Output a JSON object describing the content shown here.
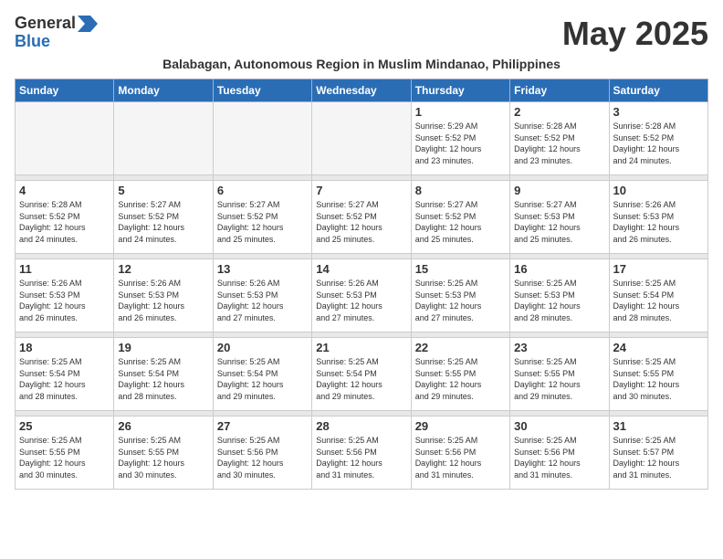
{
  "header": {
    "logo_general": "General",
    "logo_blue": "Blue",
    "month_title": "May 2025",
    "subtitle": "Balabagan, Autonomous Region in Muslim Mindanao, Philippines"
  },
  "weekdays": [
    "Sunday",
    "Monday",
    "Tuesday",
    "Wednesday",
    "Thursday",
    "Friday",
    "Saturday"
  ],
  "weeks": [
    [
      {
        "day": "",
        "info": ""
      },
      {
        "day": "",
        "info": ""
      },
      {
        "day": "",
        "info": ""
      },
      {
        "day": "",
        "info": ""
      },
      {
        "day": "1",
        "info": "Sunrise: 5:29 AM\nSunset: 5:52 PM\nDaylight: 12 hours\nand 23 minutes."
      },
      {
        "day": "2",
        "info": "Sunrise: 5:28 AM\nSunset: 5:52 PM\nDaylight: 12 hours\nand 23 minutes."
      },
      {
        "day": "3",
        "info": "Sunrise: 5:28 AM\nSunset: 5:52 PM\nDaylight: 12 hours\nand 24 minutes."
      }
    ],
    [
      {
        "day": "4",
        "info": "Sunrise: 5:28 AM\nSunset: 5:52 PM\nDaylight: 12 hours\nand 24 minutes."
      },
      {
        "day": "5",
        "info": "Sunrise: 5:27 AM\nSunset: 5:52 PM\nDaylight: 12 hours\nand 24 minutes."
      },
      {
        "day": "6",
        "info": "Sunrise: 5:27 AM\nSunset: 5:52 PM\nDaylight: 12 hours\nand 25 minutes."
      },
      {
        "day": "7",
        "info": "Sunrise: 5:27 AM\nSunset: 5:52 PM\nDaylight: 12 hours\nand 25 minutes."
      },
      {
        "day": "8",
        "info": "Sunrise: 5:27 AM\nSunset: 5:52 PM\nDaylight: 12 hours\nand 25 minutes."
      },
      {
        "day": "9",
        "info": "Sunrise: 5:27 AM\nSunset: 5:53 PM\nDaylight: 12 hours\nand 25 minutes."
      },
      {
        "day": "10",
        "info": "Sunrise: 5:26 AM\nSunset: 5:53 PM\nDaylight: 12 hours\nand 26 minutes."
      }
    ],
    [
      {
        "day": "11",
        "info": "Sunrise: 5:26 AM\nSunset: 5:53 PM\nDaylight: 12 hours\nand 26 minutes."
      },
      {
        "day": "12",
        "info": "Sunrise: 5:26 AM\nSunset: 5:53 PM\nDaylight: 12 hours\nand 26 minutes."
      },
      {
        "day": "13",
        "info": "Sunrise: 5:26 AM\nSunset: 5:53 PM\nDaylight: 12 hours\nand 27 minutes."
      },
      {
        "day": "14",
        "info": "Sunrise: 5:26 AM\nSunset: 5:53 PM\nDaylight: 12 hours\nand 27 minutes."
      },
      {
        "day": "15",
        "info": "Sunrise: 5:25 AM\nSunset: 5:53 PM\nDaylight: 12 hours\nand 27 minutes."
      },
      {
        "day": "16",
        "info": "Sunrise: 5:25 AM\nSunset: 5:53 PM\nDaylight: 12 hours\nand 28 minutes."
      },
      {
        "day": "17",
        "info": "Sunrise: 5:25 AM\nSunset: 5:54 PM\nDaylight: 12 hours\nand 28 minutes."
      }
    ],
    [
      {
        "day": "18",
        "info": "Sunrise: 5:25 AM\nSunset: 5:54 PM\nDaylight: 12 hours\nand 28 minutes."
      },
      {
        "day": "19",
        "info": "Sunrise: 5:25 AM\nSunset: 5:54 PM\nDaylight: 12 hours\nand 28 minutes."
      },
      {
        "day": "20",
        "info": "Sunrise: 5:25 AM\nSunset: 5:54 PM\nDaylight: 12 hours\nand 29 minutes."
      },
      {
        "day": "21",
        "info": "Sunrise: 5:25 AM\nSunset: 5:54 PM\nDaylight: 12 hours\nand 29 minutes."
      },
      {
        "day": "22",
        "info": "Sunrise: 5:25 AM\nSunset: 5:55 PM\nDaylight: 12 hours\nand 29 minutes."
      },
      {
        "day": "23",
        "info": "Sunrise: 5:25 AM\nSunset: 5:55 PM\nDaylight: 12 hours\nand 29 minutes."
      },
      {
        "day": "24",
        "info": "Sunrise: 5:25 AM\nSunset: 5:55 PM\nDaylight: 12 hours\nand 30 minutes."
      }
    ],
    [
      {
        "day": "25",
        "info": "Sunrise: 5:25 AM\nSunset: 5:55 PM\nDaylight: 12 hours\nand 30 minutes."
      },
      {
        "day": "26",
        "info": "Sunrise: 5:25 AM\nSunset: 5:55 PM\nDaylight: 12 hours\nand 30 minutes."
      },
      {
        "day": "27",
        "info": "Sunrise: 5:25 AM\nSunset: 5:56 PM\nDaylight: 12 hours\nand 30 minutes."
      },
      {
        "day": "28",
        "info": "Sunrise: 5:25 AM\nSunset: 5:56 PM\nDaylight: 12 hours\nand 31 minutes."
      },
      {
        "day": "29",
        "info": "Sunrise: 5:25 AM\nSunset: 5:56 PM\nDaylight: 12 hours\nand 31 minutes."
      },
      {
        "day": "30",
        "info": "Sunrise: 5:25 AM\nSunset: 5:56 PM\nDaylight: 12 hours\nand 31 minutes."
      },
      {
        "day": "31",
        "info": "Sunrise: 5:25 AM\nSunset: 5:57 PM\nDaylight: 12 hours\nand 31 minutes."
      }
    ]
  ]
}
